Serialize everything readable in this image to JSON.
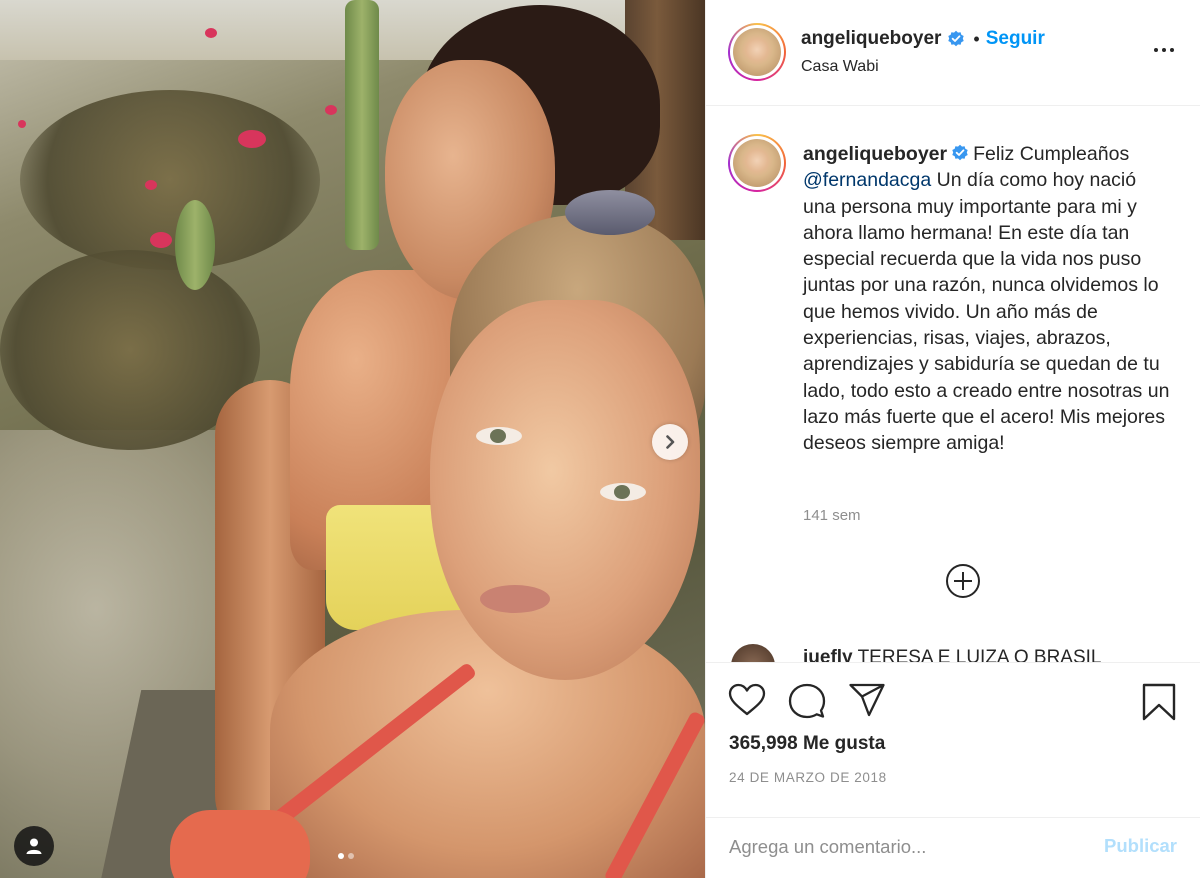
{
  "post": {
    "carousel": {
      "slide_count": 2,
      "active_slide": 1
    },
    "icons": {
      "next": "chevron-right-icon",
      "tagged_users": "user-icon",
      "more": "more-options-icon",
      "verified": "verified-badge-icon",
      "load_more": "plus-circle-icon",
      "like": "heart-icon",
      "comment": "comment-icon",
      "share": "share-icon",
      "save": "bookmark-icon"
    }
  },
  "header": {
    "username": "angeliqueboyer",
    "separator": "•",
    "follow_label": "Seguir",
    "location": "Casa Wabi"
  },
  "caption": {
    "username": "angeliqueboyer",
    "text_before": "Feliz Cumpleaños",
    "mention": "@fernandacga",
    "text_after": "Un día como hoy nació una persona muy importante para mi y ahora llamo hermana! En este día tan especial recuerda que la vida nos puso juntas por una razón, nunca olvidemos lo que hemos vivido. Un año más de experiencias, risas, viajes, abrazos, aprendizajes y sabiduría se quedan de tu lado, todo esto a creado entre nosotras un lazo más fuerte que el acero! Mis mejores deseos siempre amiga!",
    "time_ago": "141 sem"
  },
  "next_comment": {
    "username": "iuefly",
    "text": "TERESA E LUIZA  O BRASIL"
  },
  "stats": {
    "likes": "365,998 Me gusta",
    "date": "24 DE MARZO DE 2018"
  },
  "comment_box": {
    "placeholder": "Agrega un comentario...",
    "publish_label": "Publicar"
  },
  "colors": {
    "link_blue": "#0095f6",
    "publish_disabled": "#b2dffc",
    "secondary_text": "#8e8e8e",
    "mention": "#00376b",
    "border": "#efefef"
  }
}
